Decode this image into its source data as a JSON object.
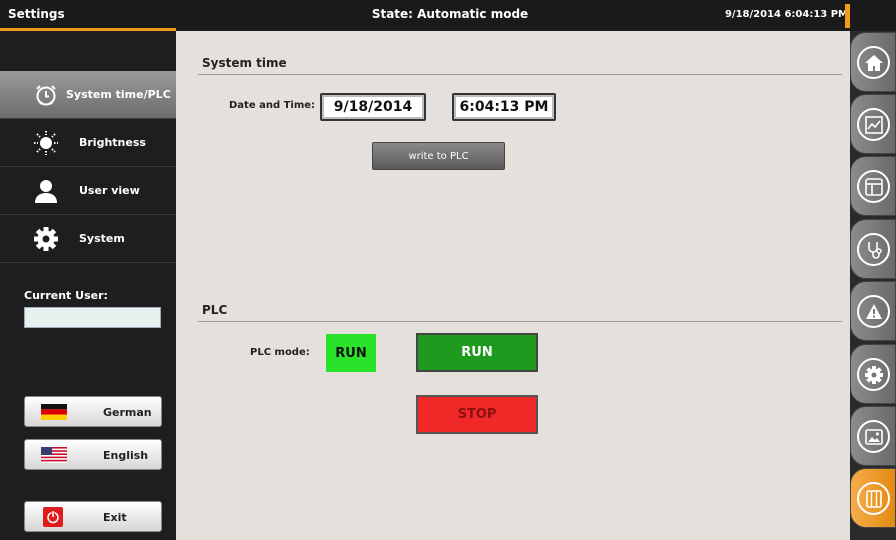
{
  "titlebar": {
    "app_title": "Settings",
    "state": "State: Automatic mode",
    "datetime": "9/18/2014 6:04:13 PM"
  },
  "sidebar": {
    "items": [
      {
        "label": "System time/PLC",
        "icon": "alarm-clock-icon"
      },
      {
        "label": "Brightness",
        "icon": "sun-icon"
      },
      {
        "label": "User view",
        "icon": "user-icon"
      },
      {
        "label": "System",
        "icon": "gear-icon"
      }
    ],
    "current_user_label": "Current User:",
    "current_user_value": "",
    "languages": [
      {
        "label": "German",
        "icon": "german-flag-icon"
      },
      {
        "label": "English",
        "icon": "us-flag-icon"
      }
    ],
    "exit_label": "Exit"
  },
  "system_time": {
    "title": "System time",
    "date_time_label": "Date and Time:",
    "date": "9/18/2014",
    "time": "6:04:13 PM",
    "write_button": "write to PLC"
  },
  "plc": {
    "title": "PLC",
    "mode_label": "PLC mode:",
    "mode_value": "RUN",
    "run_button": "RUN",
    "stop_button": "STOP"
  },
  "rightnav": {
    "icons": [
      "home-icon",
      "chart-icon",
      "layout-icon",
      "stethoscope-icon",
      "warning-icon",
      "settings-icon",
      "image-icon",
      "grid-icon"
    ]
  },
  "colors": {
    "accent": "#f39a1c",
    "plc_indicator": "#2be22b",
    "run": "#1e9a1e",
    "stop": "#f02828"
  }
}
